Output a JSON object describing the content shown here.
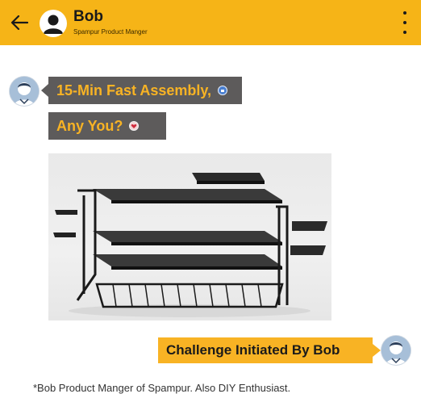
{
  "header": {
    "name": "Bob",
    "subtitle": "Spampur Product Manger",
    "back_icon": "arrow-left-icon",
    "menu_icon": "more-vertical-icon",
    "background": "#f6b417"
  },
  "messages": [
    {
      "sender": "bob",
      "text": "15-Min Fast Assembly,",
      "emoji": "thumbs-up-emoji"
    },
    {
      "sender": "bob",
      "text": "Any You?",
      "emoji": "heart-emoji"
    },
    {
      "sender": "bob",
      "image": "shoe-rack-product-photo"
    },
    {
      "sender": "me",
      "text": "Challenge Initiated By Bob"
    }
  ],
  "footnote": "*Bob Product Manger of Spampur. Also DIY Enthusiast.",
  "colors": {
    "bubble_dark": "#5d5b5b",
    "accent": "#f8b324"
  }
}
